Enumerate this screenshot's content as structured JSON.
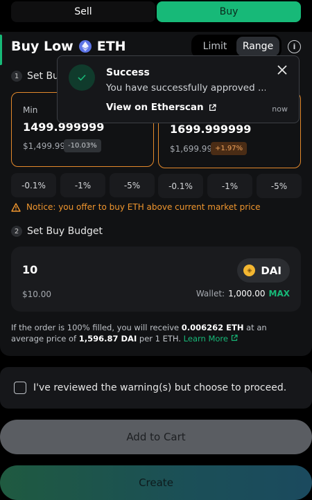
{
  "order_side": {
    "sell_label": "Sell",
    "buy_label": "Buy",
    "selected": "Buy"
  },
  "header": {
    "title": "Buy Low",
    "token": "ETH",
    "mode_limit": "Limit",
    "mode_range": "Range",
    "mode_selected": "Range",
    "info_icon": "info-icon"
  },
  "step1": {
    "number": "1",
    "label": "Set Buy Range"
  },
  "range": {
    "min": {
      "label": "Min",
      "value": "1499.999999",
      "usd": "$1,499.99",
      "pct": "-10.03%"
    },
    "max": {
      "value": "1699.999999",
      "usd": "$1,699.99",
      "pct": "+1.97%"
    }
  },
  "adjust_min": [
    "-0.1%",
    "-1%",
    "-5%"
  ],
  "adjust_max": [
    "-0.1%",
    "-1%",
    "-5%"
  ],
  "notice": {
    "icon": "warning-icon",
    "text": "Notice: you offer to buy ETH above current market price"
  },
  "step2": {
    "number": "2",
    "label": "Set Buy Budget"
  },
  "budget": {
    "amount": "10",
    "usd": "$10.00",
    "token": "DAI",
    "wallet_label": "Wallet:",
    "wallet_balance": "1,000.00",
    "max_label": "MAX"
  },
  "summary": {
    "p1": "If the order is 100% filled, you will receive ",
    "receive": "0.006262 ETH",
    "p2": " at an average price of ",
    "avg_price": "1,596.87 DAI",
    "p3": " per 1 ETH. ",
    "learn_more": "Learn More"
  },
  "review": {
    "label": "I've reviewed the warning(s) but choose to proceed.",
    "checked": false
  },
  "buttons": {
    "add_to_cart": "Add to Cart",
    "create": "Create"
  },
  "toast": {
    "title": "Success",
    "message": "You have successfully approved ...",
    "link": "View on Etherscan",
    "time": "now"
  },
  "colors": {
    "accent": "#17b978",
    "warning": "#e58a2c",
    "background": "#000000",
    "panel": "#111214"
  }
}
